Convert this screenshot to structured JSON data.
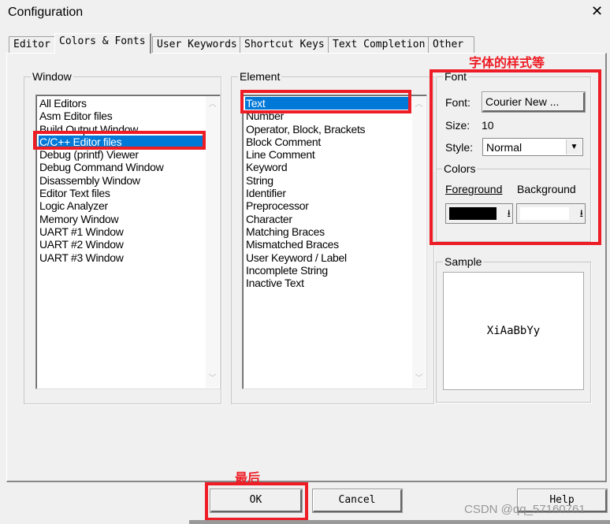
{
  "window": {
    "title": "Configuration",
    "close": "✕"
  },
  "tabs": [
    {
      "label": "Editor"
    },
    {
      "label": "Colors & Fonts",
      "active": true
    },
    {
      "label": "User Keywords"
    },
    {
      "label": "Shortcut Keys"
    },
    {
      "label": "Text Completion"
    },
    {
      "label": "Other"
    }
  ],
  "window_group": {
    "label": "Window",
    "items": [
      "All Editors",
      "Asm Editor files",
      "Build Output Window",
      "C/C++ Editor files",
      "Debug (printf) Viewer",
      "Debug Command Window",
      "Disassembly Window",
      "Editor Text files",
      "Logic Analyzer",
      "Memory Window",
      "UART #1 Window",
      "UART #2 Window",
      "UART #3 Window"
    ],
    "selected": "C/C++ Editor files"
  },
  "element_group": {
    "label": "Element",
    "items": [
      "Text",
      "Number",
      "Operator, Block, Brackets",
      "Block Comment",
      "Line Comment",
      "Keyword",
      "String",
      "Identifier",
      "Preprocessor",
      "Character",
      "Matching Braces",
      "Mismatched Braces",
      "User Keyword / Label",
      "Incomplete String",
      "Inactive Text"
    ],
    "selected": "Text"
  },
  "font_group": {
    "label": "Font",
    "font_label": "Font:",
    "font_button": "Courier New ...",
    "size_label": "Size:",
    "size_value": "10",
    "style_label": "Style:",
    "style_value": "Normal"
  },
  "colors_group": {
    "label": "Colors",
    "foreground_label": "Foreground",
    "background_label": "Background",
    "foreground_color": "#000000",
    "background_color": "#ffffff"
  },
  "sample": {
    "label": "Sample",
    "text": "XiAaBbYy"
  },
  "buttons": {
    "ok": "OK",
    "cancel": "Cancel",
    "help": "Help"
  },
  "annotations": {
    "font_note": "字体的样式等",
    "ok_note": "最后",
    "highlight_color": "#ee1c25"
  },
  "watermark": "CSDN @qq_57160761"
}
